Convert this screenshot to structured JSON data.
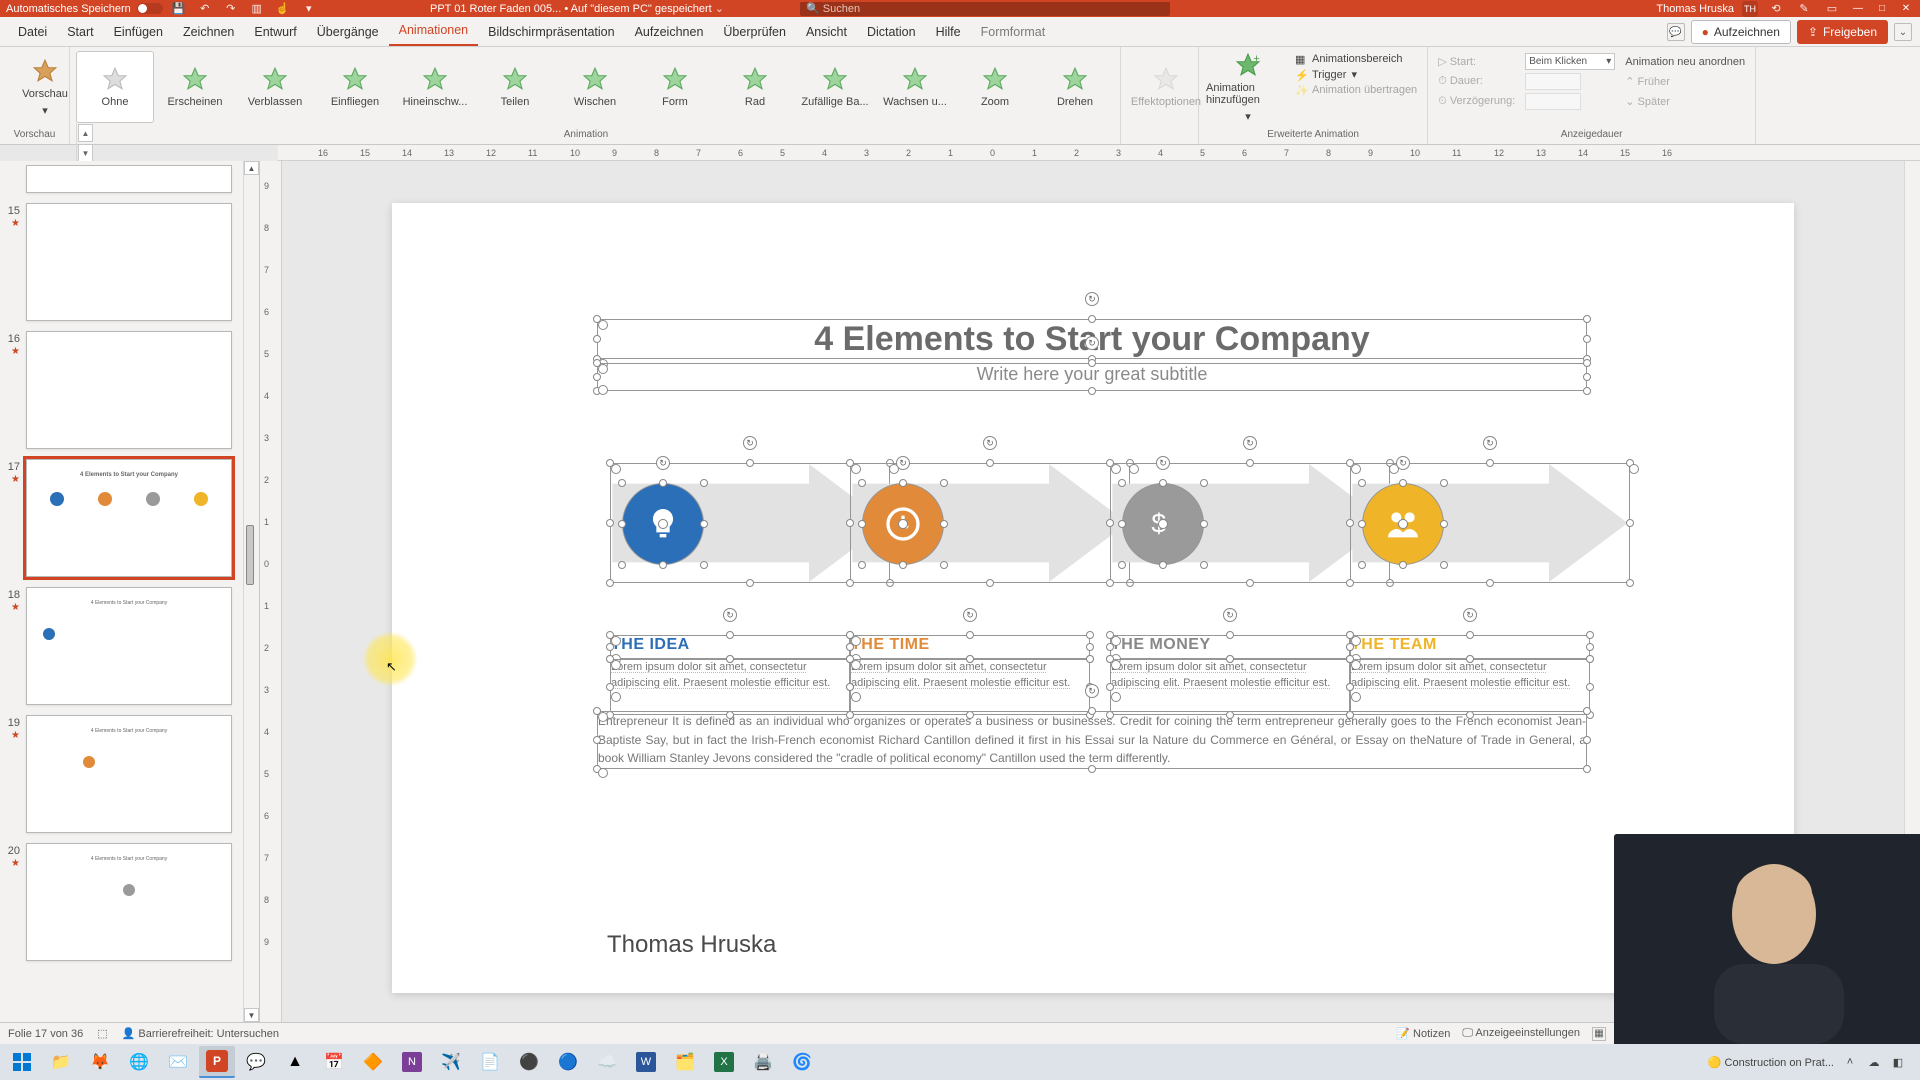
{
  "titlebar": {
    "autosave": "Automatisches Speichern",
    "filename": "PPT 01 Roter Faden 005...",
    "saved": "Auf \"diesem PC\" gespeichert",
    "search_placeholder": "Suchen",
    "user": "Thomas Hruska",
    "user_initials": "TH"
  },
  "menu": {
    "tabs": [
      "Datei",
      "Start",
      "Einfügen",
      "Zeichnen",
      "Entwurf",
      "Übergänge",
      "Animationen",
      "Bildschirmpräsentation",
      "Aufzeichnen",
      "Überprüfen",
      "Ansicht",
      "Dictation",
      "Hilfe",
      "Formformat"
    ],
    "active": 6,
    "record": "Aufzeichnen",
    "share": "Freigeben"
  },
  "ribbon": {
    "preview": "Vorschau",
    "animations": [
      "Ohne",
      "Erscheinen",
      "Verblassen",
      "Einfliegen",
      "Hineinschw...",
      "Teilen",
      "Wischen",
      "Form",
      "Rad",
      "Zufällige Ba...",
      "Wachsen u...",
      "Zoom",
      "Drehen"
    ],
    "group_anim": "Animation",
    "effect_opts": "Effektoptionen",
    "add_anim": "Animation hinzufügen",
    "anim_pane": "Animationsbereich",
    "trigger": "Trigger",
    "copy_anim": "Animation übertragen",
    "group_adv": "Erweiterte Animation",
    "start_lbl": "Start:",
    "start_val": "Beim Klicken",
    "dur_lbl": "Dauer:",
    "delay_lbl": "Verzögerung:",
    "reorder": "Animation neu anordnen",
    "earlier": "Früher",
    "later": "Später",
    "group_timing": "Anzeigedauer"
  },
  "thumbs": [
    {
      "n": "15"
    },
    {
      "n": "16"
    },
    {
      "n": "17",
      "active": true
    },
    {
      "n": "18"
    },
    {
      "n": "19"
    },
    {
      "n": "20"
    }
  ],
  "slide": {
    "title": "4 Elements to Start your Company",
    "subtitle": "Write here your great subtitle",
    "cols": [
      {
        "h": "THE IDEA",
        "body": "Lorem ipsum dolor sit amet, consectetur adipiscing elit. Praesent molestie efficitur est."
      },
      {
        "h": "THE TIME",
        "body": "Lorem ipsum dolor sit amet, consectetur adipiscing elit. Praesent molestie efficitur est."
      },
      {
        "h": "THE MONEY",
        "body": "Lorem ipsum dolor sit amet, consectetur adipiscing elit. Praesent molestie efficitur est."
      },
      {
        "h": "THE TEAM",
        "body": "Lorem ipsum dolor sit amet, consectetur adipiscing elit. Praesent molestie efficitur est."
      }
    ],
    "para": "Entrepreneur   It is defined as an individual who organizes or operates a business or businesses. Credit for coining the term entrepreneur generally goes to the French economist Jean-Baptiste Say, but in fact the Irish-French economist Richard Cantillon defined it first in his Essai sur la Nature du Commerce en Général, or Essay on theNature of Trade in General, a book William Stanley Jevons considered the \"cradle of political economy\" Cantillon used the term differently.",
    "author": "Thomas Hruska"
  },
  "status": {
    "slide_of": "Folie 17 von 36",
    "access": "Barrierefreiheit: Untersuchen",
    "notes": "Notizen",
    "display": "Anzeigeeinstellungen"
  },
  "taskbar": {
    "notif": "Construction on Prat..."
  }
}
